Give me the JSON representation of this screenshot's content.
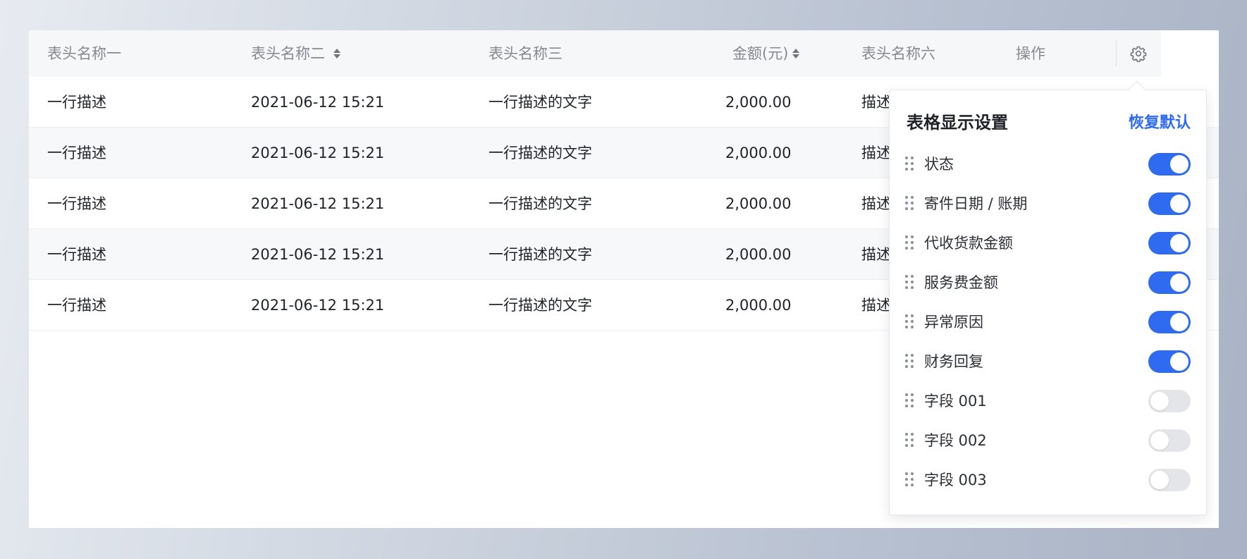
{
  "table": {
    "headers": [
      {
        "label": "表头名称一",
        "sortable": false
      },
      {
        "label": "表头名称二",
        "sortable": true
      },
      {
        "label": "表头名称三",
        "sortable": false
      },
      {
        "label": "金额(元)",
        "sortable": true
      },
      {
        "label": "表头名称六",
        "sortable": false
      },
      {
        "label": "操作",
        "sortable": false
      }
    ],
    "settings_icon": "gear-icon",
    "rows": [
      [
        "一行描述",
        "2021-06-12 15:21",
        "一行描述的文字",
        "2,000.00",
        "描述"
      ],
      [
        "一行描述",
        "2021-06-12 15:21",
        "一行描述的文字",
        "2,000.00",
        "描述"
      ],
      [
        "一行描述",
        "2021-06-12 15:21",
        "一行描述的文字",
        "2,000.00",
        "描述"
      ],
      [
        "一行描述",
        "2021-06-12 15:21",
        "一行描述的文字",
        "2,000.00",
        "描述"
      ],
      [
        "一行描述",
        "2021-06-12 15:21",
        "一行描述的文字",
        "2,000.00",
        "描述"
      ]
    ]
  },
  "settings_panel": {
    "title": "表格显示设置",
    "reset_label": "恢复默认",
    "items": [
      {
        "label": "状态",
        "enabled": true
      },
      {
        "label": "寄件日期 / 账期",
        "enabled": true
      },
      {
        "label": "代收货款金额",
        "enabled": true
      },
      {
        "label": "服务费金额",
        "enabled": true
      },
      {
        "label": "异常原因",
        "enabled": true
      },
      {
        "label": "财务回复",
        "enabled": true
      },
      {
        "label": "字段 001",
        "enabled": false
      },
      {
        "label": "字段 002",
        "enabled": false
      },
      {
        "label": "字段 003",
        "enabled": false
      }
    ]
  },
  "colors": {
    "accent": "#2e6bf0",
    "header_bg": "#f6f7f9",
    "row_alt_bg": "#f7f8fa",
    "toggle_off": "#e3e5e9"
  }
}
